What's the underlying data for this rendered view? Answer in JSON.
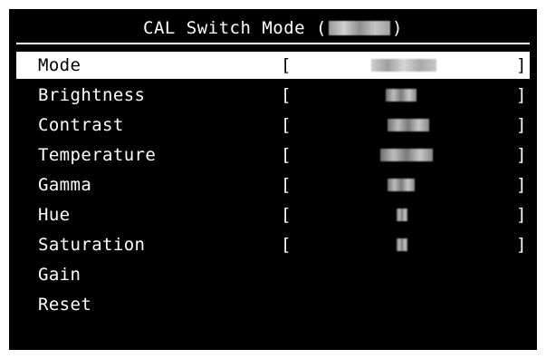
{
  "window": {
    "title_prefix": "CAL Switch Mode (",
    "title_suffix": ")"
  },
  "menu": {
    "bracket_left": "[",
    "bracket_right": "]",
    "items": [
      {
        "label": "Mode",
        "selected": true,
        "has_value": true
      },
      {
        "label": "Brightness",
        "selected": false,
        "has_value": true
      },
      {
        "label": "Contrast",
        "selected": false,
        "has_value": true
      },
      {
        "label": "Temperature",
        "selected": false,
        "has_value": true
      },
      {
        "label": "Gamma",
        "selected": false,
        "has_value": true
      },
      {
        "label": "Hue",
        "selected": false,
        "has_value": true
      },
      {
        "label": "Saturation",
        "selected": false,
        "has_value": true
      },
      {
        "label": "Gain",
        "selected": false,
        "has_value": false
      },
      {
        "label": "Reset",
        "selected": false,
        "has_value": false
      }
    ]
  },
  "colors": {
    "osd_background": "#000000",
    "text": "#ffffff",
    "selection_background": "#ffffff",
    "selection_text": "#000000"
  }
}
